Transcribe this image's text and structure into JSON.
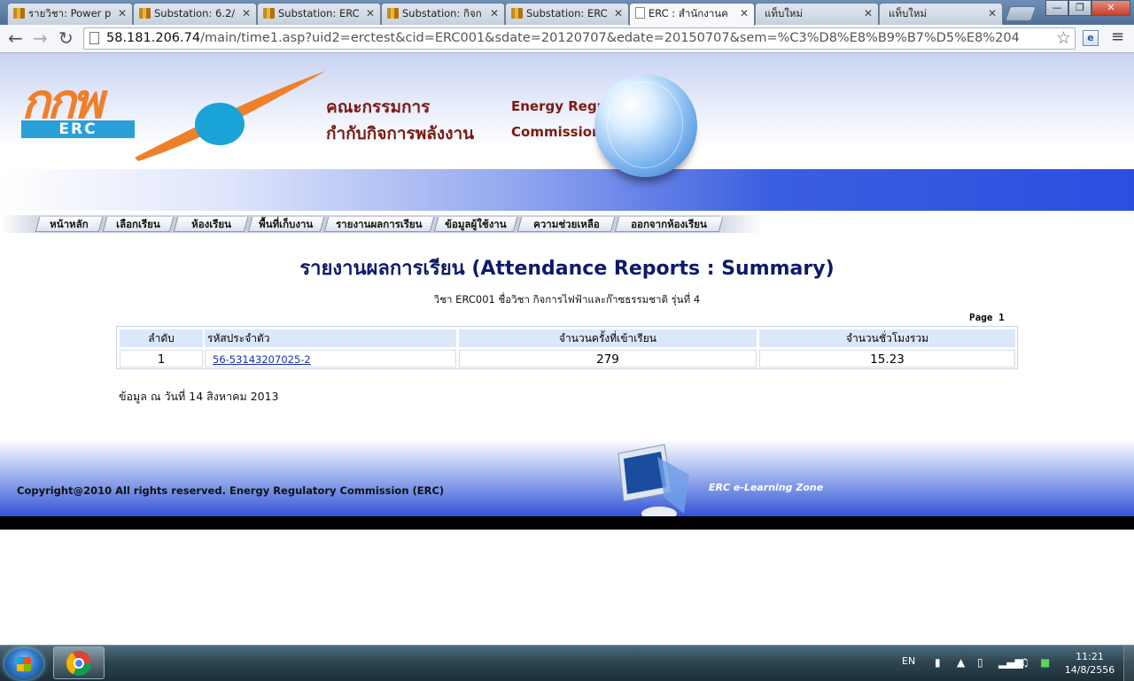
{
  "browser": {
    "tabs": [
      {
        "title": "รายวิชา: Power p",
        "icon": "book-icon"
      },
      {
        "title": "Substation: 6.2/",
        "icon": "book-icon"
      },
      {
        "title": "Substation: ERC",
        "icon": "book-icon"
      },
      {
        "title": "Substation: กิจก",
        "icon": "book-icon"
      },
      {
        "title": "Substation: ERC",
        "icon": "book-icon"
      },
      {
        "title": "ERC : สำนักงานค",
        "icon": "page-icon",
        "active": true
      },
      {
        "title": "แท็บใหม่",
        "icon": "none"
      },
      {
        "title": "แท็บใหม่",
        "icon": "none"
      }
    ],
    "url_host": "58.181.206.74",
    "url_path": "/main/time1.asp?uid2=erctest&cid=ERC001&sdate=20120707&edate=20150707&sem=%C3%D8%E8%B9%B7%D5%E8%204",
    "window_controls": {
      "minimize": "—",
      "maximize": "❐",
      "close": "✕"
    }
  },
  "banner": {
    "logo_text": "กกพ",
    "logo_sub": "ERC",
    "thai_title_line1": "คณะกรรมการ",
    "thai_title_line2": "กำกับกิจการพลังงาน",
    "en_title_line1": "Energy Regulatory",
    "en_title_line2": "Commission Of Thailand"
  },
  "nav": {
    "items": [
      "หน้าหลัก",
      "เลือกเรียน",
      "ห้องเรียน",
      "พื้นที่เก็บงาน",
      "รายงานผลการเรียน",
      "ข้อมูลผู้ใช้งาน",
      "ความช่วยเหลือ",
      "ออกจากห้องเรียน"
    ]
  },
  "report": {
    "title": "รายงานผลการเรียน (Attendance Reports : Summary)",
    "course_line": "วิชา ERC001 ชื่อวิชา กิจการไฟฟ้าและก๊าซธรรมชาติ   รุ่นที่ 4",
    "page_label": "Page  1",
    "headers": [
      "ลำดับ",
      "รหัสประจำตัว",
      "จำนวนครั้งที่เข้าเรียน",
      "จำนวนชั่วโมงรวม"
    ],
    "rows": [
      {
        "no": "1",
        "id": "56-53143207025-2",
        "count": "279",
        "hours": "15.23"
      }
    ],
    "data_date": "ข้อมูล ณ วันที่   14   สิงหาคม   2013"
  },
  "footer": {
    "copyright": "Copyright@2010  All  rights  reserved.  Energy  Regulatory  Commission  (ERC)",
    "zone": "ERC e-Learning Zone"
  },
  "taskbar": {
    "lang": "EN",
    "time": "11:21",
    "date": "14/8/2556"
  },
  "colors": {
    "title": "#0e1a6b",
    "brand_orange": "#f07f2a",
    "brand_blue": "#2a9fd8",
    "banner_blue": "#2a4fe0",
    "header_cell": "#dbe8fa"
  }
}
